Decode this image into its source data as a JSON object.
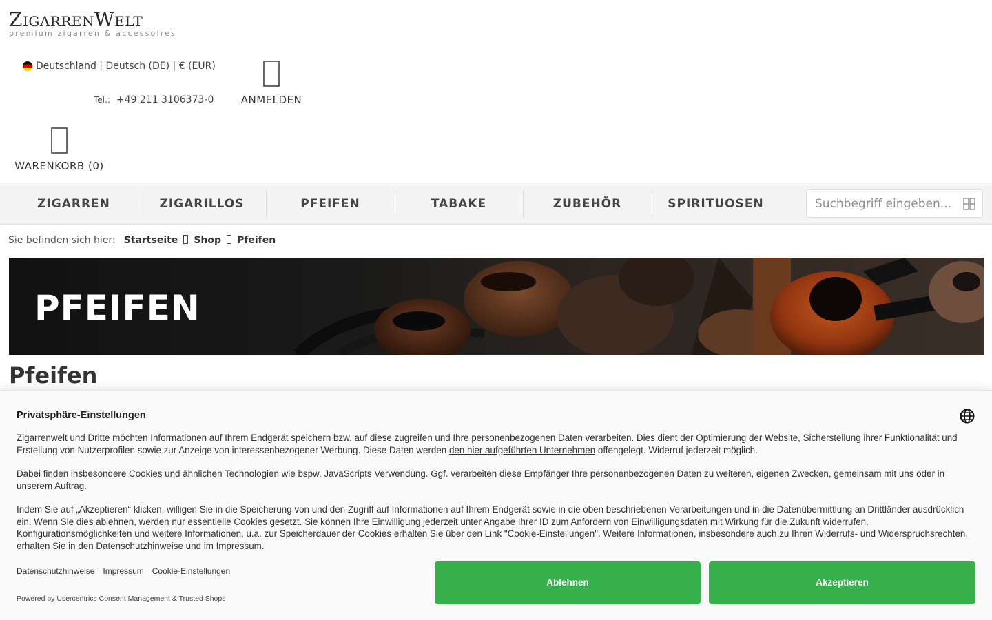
{
  "brand": {
    "name": "ZigarrenWelt",
    "tagline": "premium zigarren & accessoires"
  },
  "header": {
    "locale": "Deutschland | Deutsch (DE) | € (EUR)",
    "phone_label": "Tel.:",
    "phone": "+49 211 3106373-0",
    "login_label": "ANMELDEN",
    "cart_label": "WARENKORB (0)",
    "icons": {
      "login": "user-icon",
      "cart": "shopping-bag-icon",
      "flag": "germany-flag-icon"
    }
  },
  "nav": {
    "items": [
      "ZIGARREN",
      "ZIGARILLOS",
      "PFEIFEN",
      "TABAKE",
      "ZUBEHÖR",
      "SPIRITUOSEN"
    ],
    "search_placeholder": "Suchbegriff eingeben..."
  },
  "breadcrumb": {
    "prefix": "Sie befinden sich hier:",
    "items": [
      "Startseite",
      "Shop",
      "Pfeifen"
    ]
  },
  "banner": {
    "title": "PFEIFEN"
  },
  "page": {
    "title": "Pfeifen"
  },
  "consent": {
    "title": "Privatsphäre-Einstellungen",
    "p1_a": "Zigarrenwelt und Dritte möchten Informationen auf Ihrem Endgerät speichern bzw. auf diese zugreifen und Ihre personenbezogenen Daten verarbeiten. Dies dient der Optimierung der Website, Sicherstellung ihrer Funktionalität und Erstellung von Nutzerprofilen sowie zur Anzeige von interessenbezogener Werbung. Diese Daten werden ",
    "p1_link": "den hier aufgeführten Unternehmen",
    "p1_b": " offengelegt. Widerruf jederzeit möglich.",
    "p2": "Dabei finden insbesondere Cookies und ähnlichen Technologien wie bspw. JavaScripts Verwendung. Ggf. verarbeiten diese Empfänger Ihre personenbezogenen Daten zu weiteren, eigenen Zwecken, gemeinsam mit uns oder in unserem Auftrag.",
    "p3_a": "Indem Sie auf „Akzeptieren“ klicken, willigen Sie in die Speicherung von und den Zugriff auf Informationen auf Ihrem Endgerät sowie in die oben beschriebenen Verarbeitungen und in die Datenübermittlung an Drittländer ausdrücklich ein. Wenn Sie dies ablehnen, werden nur essentielle Cookies gesetzt. Sie können Ihre Einwilligung jederzeit unter Angabe Ihrer ID zum Anfordern von Einwilligungsdaten mit Wirkung für die Zukunft widerrufen. Konfigurationsmöglichkeiten und weitere Informationen, u.a. zur Speicherdauer der Cookies erhalten Sie über den Link \"Cookie-Einstellungen\". Weitere Informationen, insbesondere auch zu Ihren Widerrufs- und Widerspruchsrechten, erhalten Sie in den ",
    "p3_link1": "Datenschutzhinweise",
    "p3_mid": " und im ",
    "p3_link2": "Impressum",
    "p3_end": ".",
    "links": [
      "Datenschutzhinweise",
      "Impressum",
      "Cookie-Einstellungen"
    ],
    "powered_by": "Powered by Usercentrics Consent Management & Trusted Shops",
    "decline_label": "Ablehnen",
    "accept_label": "Akzeptieren",
    "accent_color": "#36b04a"
  }
}
